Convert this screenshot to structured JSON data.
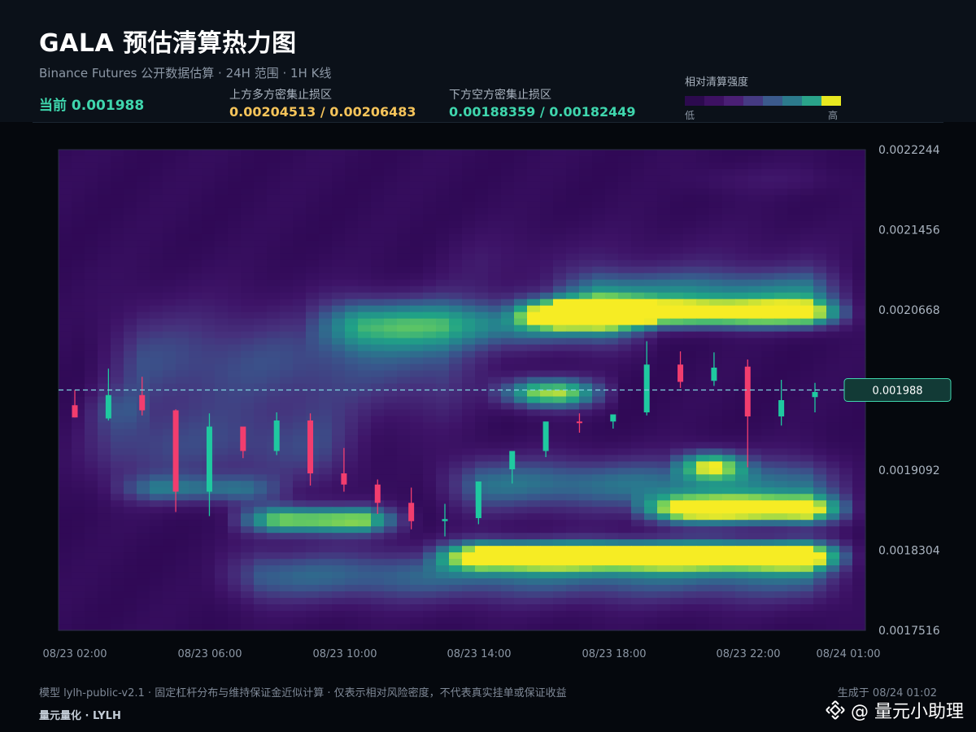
{
  "header": {
    "title": "GALA 预估清算热力图",
    "subtitle": "Binance Futures 公开数据估算 · 24H 范围 · 1H K线",
    "current_label": "当前 0.001988",
    "upper_zone_label": "上方多方密集止损区",
    "upper_zone_value": "0.00204513 / 0.00206483",
    "lower_zone_label": "下方空方密集止损区",
    "lower_zone_value": "0.00188359 / 0.00182449",
    "legend_title": "相对清算强度",
    "legend_low": "低",
    "legend_high": "高",
    "legend_colors": [
      "#2c0a4e",
      "#3d1162",
      "#4a1f74",
      "#453a82",
      "#3b5a8c",
      "#2c7a8c",
      "#2aa38a",
      "#e8e820"
    ]
  },
  "footer": {
    "note": "模型 lylh-public-v2.1 · 固定杠杆分布与维持保证金近似计算 · 仅表示相对风险密度，不代表真实挂单或保证收益",
    "brand": "量元量化 · LYLH",
    "generated": "生成于 08/24 01:02",
    "watermark": "@ 量元小助理"
  },
  "chart_data": {
    "type": "heatmap",
    "overlay_type": "candlestick",
    "ylim": [
      0.0017516,
      0.0022244
    ],
    "y_ticks": [
      "0.0022244",
      "0.0021456",
      "0.0020668",
      "0.0019880",
      "0.0019092",
      "0.0018304",
      "0.0017516"
    ],
    "x_ticks": [
      "08/23 02:00",
      "08/23 06:00",
      "08/23 10:00",
      "08/23 14:00",
      "08/23 18:00",
      "08/23 22:00",
      "08/24 01:00"
    ],
    "current_price": 0.001988,
    "current_price_label": "0.001988",
    "up_color": "#1fc9a0",
    "down_color": "#f23d6e",
    "candles": [
      {
        "o": 0.001973,
        "h": 0.001988,
        "l": 0.001961,
        "c": 0.001961
      },
      {
        "o": 0.00196,
        "h": 0.002009,
        "l": 0.001958,
        "c": 0.001983
      },
      {
        "o": 0.001983,
        "h": 0.002001,
        "l": 0.001963,
        "c": 0.001968
      },
      {
        "o": 0.001968,
        "h": 0.001969,
        "l": 0.001868,
        "c": 0.001888
      },
      {
        "o": 0.001888,
        "h": 0.001965,
        "l": 0.001864,
        "c": 0.001952
      },
      {
        "o": 0.001952,
        "h": 0.001952,
        "l": 0.001921,
        "c": 0.001928
      },
      {
        "o": 0.001928,
        "h": 0.001966,
        "l": 0.001924,
        "c": 0.001958
      },
      {
        "o": 0.001958,
        "h": 0.001965,
        "l": 0.001894,
        "c": 0.001906
      },
      {
        "o": 0.001906,
        "h": 0.001931,
        "l": 0.001888,
        "c": 0.001895
      },
      {
        "o": 0.001895,
        "h": 0.0019,
        "l": 0.001866,
        "c": 0.001877
      },
      {
        "o": 0.001877,
        "h": 0.001892,
        "l": 0.001851,
        "c": 0.001859
      },
      {
        "o": 0.001859,
        "h": 0.001876,
        "l": 0.001844,
        "c": 0.001861
      },
      {
        "o": 0.001862,
        "h": 0.001897,
        "l": 0.001856,
        "c": 0.001898
      },
      {
        "o": 0.00191,
        "h": 0.001924,
        "l": 0.001896,
        "c": 0.001928
      },
      {
        "o": 0.001928,
        "h": 0.001953,
        "l": 0.001922,
        "c": 0.001957
      },
      {
        "o": 0.001957,
        "h": 0.001965,
        "l": 0.001946,
        "c": 0.001956
      },
      {
        "o": 0.001957,
        "h": 0.001964,
        "l": 0.00195,
        "c": 0.001964
      },
      {
        "o": 0.001966,
        "h": 0.002036,
        "l": 0.001963,
        "c": 0.002013
      },
      {
        "o": 0.002013,
        "h": 0.002026,
        "l": 0.00199,
        "c": 0.001996
      },
      {
        "o": 0.001997,
        "h": 0.002025,
        "l": 0.001992,
        "c": 0.00201
      },
      {
        "o": 0.002011,
        "h": 0.002018,
        "l": 0.001912,
        "c": 0.001962
      },
      {
        "o": 0.001962,
        "h": 0.001998,
        "l": 0.001953,
        "c": 0.001978
      },
      {
        "o": 0.001981,
        "h": 0.001995,
        "l": 0.001966,
        "c": 0.001986
      }
    ],
    "bands": [
      {
        "price": 0.002063,
        "start": 0.55,
        "end": 1.0,
        "intensity": 1.0,
        "width": 1e-05
      },
      {
        "price": 0.002053,
        "start": 0.3,
        "end": 0.75,
        "intensity": 0.55,
        "width": 1.8e-05
      },
      {
        "price": 0.001985,
        "start": 0.52,
        "end": 0.7,
        "intensity": 0.9,
        "width": 1.1e-05
      },
      {
        "price": 0.002016,
        "start": 0.03,
        "end": 0.55,
        "intensity": 0.35,
        "width": 4e-05
      },
      {
        "price": 0.00193,
        "start": 0.0,
        "end": 0.4,
        "intensity": 0.3,
        "width": 3e-05
      },
      {
        "price": 0.001914,
        "start": 0.75,
        "end": 0.87,
        "intensity": 0.95,
        "width": 1e-05
      },
      {
        "price": 0.001895,
        "start": 0.45,
        "end": 1.0,
        "intensity": 0.5,
        "width": 2e-05
      },
      {
        "price": 0.00187,
        "start": 0.7,
        "end": 1.0,
        "intensity": 0.95,
        "width": 1e-05
      },
      {
        "price": 0.00186,
        "start": 0.2,
        "end": 0.45,
        "intensity": 0.85,
        "width": 1e-05
      },
      {
        "price": 0.001825,
        "start": 0.45,
        "end": 1.0,
        "intensity": 1.0,
        "width": 1e-05
      },
      {
        "price": 0.001805,
        "start": 0.18,
        "end": 1.0,
        "intensity": 0.45,
        "width": 2e-05
      },
      {
        "price": 0.002085,
        "start": 0.6,
        "end": 1.0,
        "intensity": 0.45,
        "width": 1.5e-05
      },
      {
        "price": 0.00211,
        "start": 0.45,
        "end": 1.0,
        "intensity": 0.12,
        "width": 2.5e-05
      },
      {
        "price": 0.002195,
        "start": 0.75,
        "end": 1.0,
        "intensity": 0.1,
        "width": 1e-05
      },
      {
        "price": 0.00197,
        "start": 0.02,
        "end": 0.12,
        "intensity": 0.3,
        "width": 1.5e-05
      },
      {
        "price": 0.00189,
        "start": 0.05,
        "end": 0.3,
        "intensity": 0.4,
        "width": 1e-05
      }
    ]
  }
}
